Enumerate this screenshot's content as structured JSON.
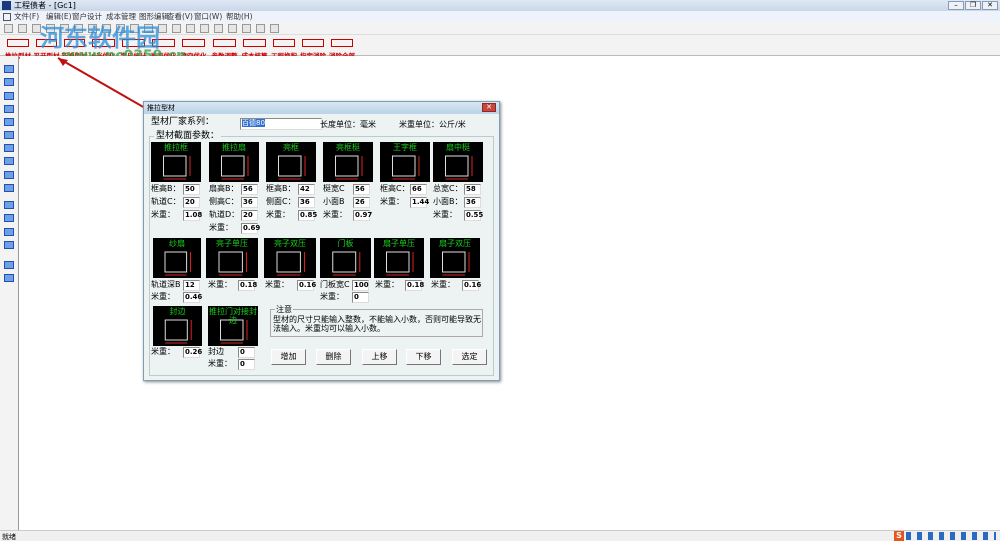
{
  "window": {
    "title": "工程债者 - [Gc1]",
    "min": "–",
    "restore": "❐",
    "close": "✕"
  },
  "menu": [
    "文件(F)",
    "编辑(E)",
    "窗户设计",
    "成本管理",
    "图形编辑",
    "查看(V)",
    "窗口(W)",
    "帮助(H)"
  ],
  "toolbar": [
    "推拉型材",
    "平开型材",
    "新增型材",
    "6米优化",
    "定尺统计",
    "画面优化",
    "清空优化",
    "参数调整",
    "成本核算",
    "工程换积",
    "指定消除",
    "消除全部"
  ],
  "watermark": {
    "text": "河东软件园",
    "url_text": "www.pc0359.cn"
  },
  "status": "就绪",
  "dialog": {
    "title": "推拉型材",
    "close": "✕",
    "series_label": "型材厂家系列：",
    "series_value": "百德80",
    "length_unit": "长度单位：毫米",
    "weight_unit": "米重单位：公斤/米",
    "group_label": "型材截面参数：",
    "row1": [
      {
        "title": "推拉框",
        "fields": [
          [
            "框高B：",
            "50"
          ],
          [
            "轨道C：",
            "20"
          ],
          [
            "米重：",
            "1.08"
          ]
        ]
      },
      {
        "title": "推拉扇",
        "fields": [
          [
            "扇高B：",
            "56"
          ],
          [
            "侧高C：",
            "36"
          ],
          [
            "轨道D：",
            "20"
          ],
          [
            "米重：",
            "0.69"
          ]
        ]
      },
      {
        "title": "亮框",
        "fields": [
          [
            "框高B：",
            "42"
          ],
          [
            "侧面C：",
            "36"
          ],
          [
            "米重：",
            "0.85"
          ]
        ]
      },
      {
        "title": "亮框梃",
        "fields": [
          [
            "梃宽C",
            "56"
          ],
          [
            "小面B",
            "26"
          ],
          [
            "米重：",
            "0.97"
          ]
        ]
      },
      {
        "title": "王字框",
        "fields": [
          [
            "框高C：",
            "66"
          ],
          [
            "米重：",
            "1.44"
          ]
        ]
      },
      {
        "title": "扇中梃",
        "fields": [
          [
            "总宽C：",
            "58"
          ],
          [
            "小面B：",
            "36"
          ],
          [
            "米重：",
            "0.55"
          ]
        ]
      }
    ],
    "row2": [
      {
        "title": "纱扇",
        "fields": [
          [
            "轨道深B",
            "12"
          ],
          [
            "米重：",
            "0.46"
          ]
        ]
      },
      {
        "title": "亮子单压",
        "fields": [
          [
            "米重：",
            "0.18"
          ]
        ]
      },
      {
        "title": "亮子双压",
        "fields": [
          [
            "米重：",
            "0.16"
          ]
        ]
      },
      {
        "title": "门板",
        "fields": [
          [
            "门板宽C",
            "100"
          ],
          [
            "米重：",
            "0"
          ]
        ]
      },
      {
        "title": "扇子单压",
        "fields": [
          [
            "米重：",
            "0.18"
          ]
        ]
      },
      {
        "title": "扇子双压",
        "fields": [
          [
            "米重：",
            "0.16"
          ]
        ]
      }
    ],
    "row3": [
      {
        "title": "封边",
        "fields": [
          [
            "米重：",
            "0.26"
          ]
        ]
      },
      {
        "title": "推拉门对接封边",
        "fields": [
          [
            "封边",
            "0"
          ],
          [
            "米重：",
            "0"
          ]
        ]
      }
    ],
    "notice_title": "注意",
    "notice_text": "型材的尺寸只能输入整数，不能输入小数，否则可能导致无法输入。米重均可以输入小数。",
    "buttons": [
      "增加",
      "删除",
      "上移",
      "下移",
      "选定"
    ]
  },
  "colors": {
    "pic_title": "#19d019",
    "toolbar_text": "#d00000",
    "title_bar": "#c9d7ea"
  }
}
